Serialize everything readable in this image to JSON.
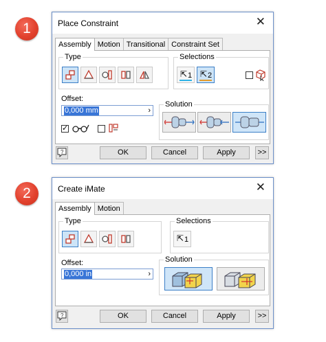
{
  "badges": [
    "1",
    "2"
  ],
  "dialog1": {
    "title": "Place Constraint",
    "close": "✕",
    "tabs": [
      "Assembly",
      "Motion",
      "Transitional",
      "Constraint Set"
    ],
    "type_label": "Type",
    "selections_label": "Selections",
    "selection_1": "1",
    "selection_2": "2",
    "offset_label": "Offset:",
    "offset_value": "0,000 mm",
    "solution_label": "Solution",
    "buttons": {
      "ok": "OK",
      "cancel": "Cancel",
      "apply": "Apply",
      "more": ">>"
    },
    "help": "?"
  },
  "dialog2": {
    "title": "Create iMate",
    "close": "✕",
    "tabs": [
      "Assembly",
      "Motion"
    ],
    "type_label": "Type",
    "selections_label": "Selections",
    "selection_1": "1",
    "offset_label": "Offset:",
    "offset_value": "0,000 in",
    "solution_label": "Solution",
    "buttons": {
      "ok": "OK",
      "cancel": "Cancel",
      "apply": "Apply",
      "more": ">>"
    },
    "help": "?"
  },
  "colors": {
    "badge": "#e2412d",
    "selected": "#cde4f7",
    "selection1_line": "#2fb3e6",
    "selection2_line": "#e39b2c",
    "highlight": "#3875d7"
  },
  "arrow_glyph": "⇱",
  "field_arrow": "›"
}
